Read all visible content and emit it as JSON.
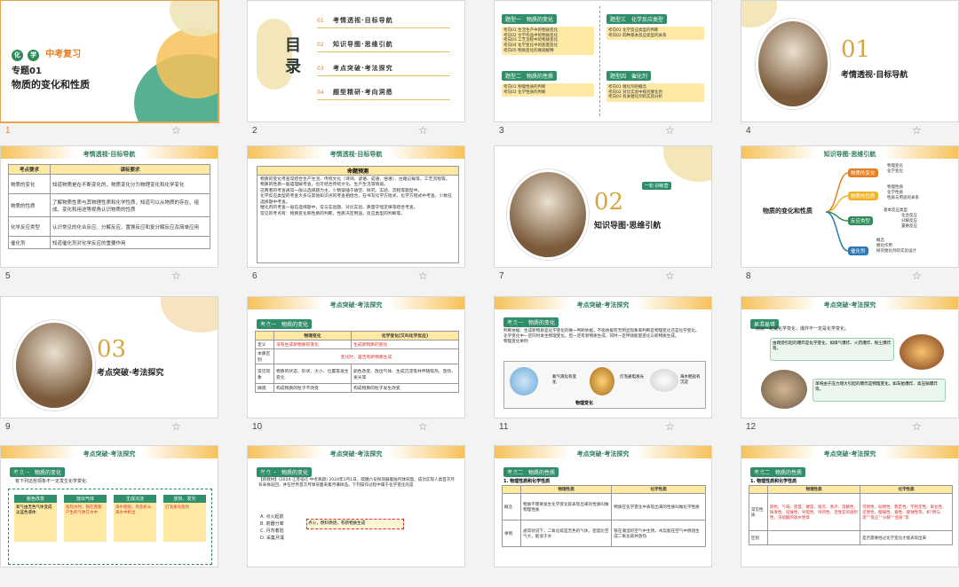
{
  "slides": [
    {
      "num": "1",
      "course_tag": "化 学",
      "course_title": "中考复习",
      "topic_no": "专题01",
      "topic_title": "物质的变化和性质"
    },
    {
      "num": "2",
      "toc_title": "目 录",
      "items": [
        {
          "no": "01",
          "text": "考情透视·目标导航"
        },
        {
          "no": "02",
          "text": "知识导图·思维引航"
        },
        {
          "no": "03",
          "text": "考点突破·考法探究"
        },
        {
          "no": "04",
          "text": "题型精研·考向洞悉"
        }
      ]
    },
    {
      "num": "3",
      "boxes": [
        {
          "head": "题型一　物质的变化",
          "lines": [
            "考向01 生活生产中的物质变化",
            "考向02 文学作品中的物质变化",
            "考向03 工艺流程中的物质变化",
            "考向04 化学变化中的能量变化",
            "考向05 物质变化的微观解释"
          ]
        },
        {
          "head": "题型三　化学反应类型",
          "lines": [
            "考向01 化学反应类型的判断",
            "考向02 四种基本反应类型的关系"
          ]
        },
        {
          "head": "题型二　物质的性质",
          "lines": [
            "考向01 物理性质的判断",
            "考向02 化学性质的判断"
          ]
        },
        {
          "head": "题型四　催化剂",
          "lines": [
            "考向01 催化剂的概念",
            "考向02 对比实验中探究催化剂",
            "考向03 有关催化剂的实验分析"
          ]
        }
      ]
    },
    {
      "num": "4",
      "big_no": "01",
      "title": "考情透视·目标导航"
    },
    {
      "num": "5",
      "header": "考情透视·目标导航",
      "col1": "考点要求",
      "col2": "课标要求",
      "rows": [
        {
          "k": "物质的变化",
          "v": "知道物质是在不断变化的，物质变化分为物理变化和化学变化"
        },
        {
          "k": "物质的性质",
          "v": "了解物质性质与其物理性质和化学性质，知道可以从物质的存在、组成、变化和用途等视角认识物质的性质"
        },
        {
          "k": "化学反应类型",
          "v": "认识常见的化合反应、分解反应、置换反应和复分解反应及简单应用"
        },
        {
          "k": "催化剂",
          "v": "知道催化剂对化学反应的重要作用"
        }
      ]
    },
    {
      "num": "6",
      "header": "考情透视·目标导航",
      "box_title": "命题预测",
      "paras": [
        "物质的变化考查常结合生产生活、传统文化（诗词、谚语、成语、俗语）、古籍记载等，工艺流程等。",
        "物质的性质一般是理解考查，也可结合传统文化、生产生活等情境。",
        "这两者的考查通常一般以选择题为主，少数穿插于填空、探究、实验、流程等题型中。",
        "化学反应类型的考查大多与其他知识点的考查相结合，在书写化学方程式、化学方程式中考查，少数在选择题中考查。",
        "催化剂的考查一般在选择题中，常与实验题、对比实验、质量守恒定律等结合考查。",
        "常见的考点有：物质变化和性质的判断，性质决定用途，反应类型的判断等。"
      ]
    },
    {
      "num": "7",
      "badge": "一轮·训练营",
      "big_no": "02",
      "title": "知识导图·思维引航"
    },
    {
      "num": "8",
      "header": "知识导图·思维引航",
      "center": "物质的变化和性质",
      "branches": [
        {
          "label": "物质的变化",
          "leaves": [
            "物理变化",
            "化学变化"
          ]
        },
        {
          "label": "物质的性质",
          "leaves": [
            "物理性质",
            "化学性质",
            "性质与用途的关系"
          ]
        },
        {
          "label": "反应类型",
          "leaves": [
            "基本反应类型",
            "化合反应",
            "分解反应",
            "置换反应",
            "复分解反应"
          ]
        },
        {
          "label": "催化剂",
          "leaves": [
            "概念",
            "催化作用",
            "探究催化剂的实验设计"
          ]
        }
      ]
    },
    {
      "num": "9",
      "big_no": "03",
      "title": "考点突破·考法探究"
    },
    {
      "num": "10",
      "header": "考点突破·考法探究",
      "tag": "考点一　物质的变化",
      "sub": "知识梳理",
      "cols": [
        "",
        "物理变化",
        "化学变化(又叫化学反应)"
      ],
      "rows": [
        {
          "k": "定义",
          "a": "没有生成新物质的变化",
          "b": "生成新物质的变化"
        },
        {
          "k": "本质区别",
          "a": "变化时，是否有新物质生成",
          "b": ""
        },
        {
          "k": "常见现象",
          "a": "物质的状态、形状、大小、位置等发生变化",
          "b": "颜色改变、放出气体、生成沉淀等并伴随吸热、放热、发光等"
        },
        {
          "k": "微观",
          "a": "构成物质的粒子不改变",
          "b": "构成物质的粒子发生改变"
        }
      ]
    },
    {
      "num": "11",
      "header": "考点突破·考法探究",
      "tag": "考点一　物质的变化",
      "sub": "知识梳理",
      "lines": [
        "判断依据：生成新物质是化学变化的唯一判断依据，不能依据有无明显现象来判断是物理变化还是化学变化。",
        "化学变化中一定同时发生物理变化，但一定有新物质生成，同时一定伴随能量变化与新物质生成。",
        "物理变化举例"
      ],
      "images": [
        "氦气液化有变化",
        "灯泡通电发光",
        "海水晒盐有沉淀"
      ],
      "foot": "物理变化"
    },
    {
      "num": "12",
      "header": "考点突破·考法探究",
      "tag": "易混易错",
      "lines": [
        "燃烧一定是化学变化，爆炸不一定是化学变化。",
        "由燃烧引起的爆炸是化学变化，如煤气爆炸、火药爆炸、粉尘爆炸等。",
        "单纯由于压力增大引起的爆炸是物理变化，如车胎爆炸、高压锅爆炸等。"
      ]
    },
    {
      "num": "13",
      "header": "考点突破·考法探究",
      "tag": "考点一　物质的变化",
      "sub": "易混易错",
      "note": "有下列这些现象不一定发生化学变化:",
      "cards": [
        {
          "head": "颜色改变",
          "body": "氧气由无色气体变成淡蓝色液体"
        },
        {
          "head": "放出气体",
          "body": "加热水时，锅在底部产生的气体在水中"
        },
        {
          "head": "生成沉淀",
          "body": "海水晒盐，有盐析从海水中析出"
        },
        {
          "head": "放热、发光",
          "body": "灯泡发光放热"
        }
      ]
    },
    {
      "num": "14",
      "header": "考点突破·考法探究",
      "tag": "考点一　物质的变化",
      "sub": "新材考查",
      "question": "【新教材】(2024·江苏宿迁·中考真题) 2024年1月1日，嫦娥六号探测器着陆月球背面，成功实现人类首次月背采样返回，并在世界首次月球背面采集月壤样品。下列操作过程中属于化学变化的是",
      "options": [
        "A. 点火起航",
        "B. 箭器分离",
        "C. 月背着陆",
        "D. 采集月壤"
      ],
      "popup": "点火，燃料燃烧，有新物质生成"
    },
    {
      "num": "15",
      "header": "考点突破·考法探究",
      "tag": "考点二　物质的性质",
      "sub": "知识梳理",
      "heading": "1. 物理性质和化学性质",
      "cols": [
        "",
        "物理性质",
        "化学性质"
      ],
      "rows": [
        {
          "k": "概念",
          "a": "物质不需要发生化学变化就表现出来的性质叫做物理性质",
          "b": "物质在化学变化中表现出来的性质叫做化学性质"
        },
        {
          "k": "举例",
          "a": "通常状况下，二氧化碳是无色的气体，密度比空气大，能溶于水",
          "b": "铁在潮湿的空气中生锈，木炭能在空气中燃烧生成二氧化碳并放热"
        }
      ]
    },
    {
      "num": "16",
      "header": "考点突破·考法探究",
      "tag": "考点二　物质的性质",
      "sub": "知识梳理",
      "heading": "1. 物理性质和化学性质",
      "cols": [
        "",
        "物理性质",
        "化学性质"
      ],
      "rows": [
        {
          "k": "常见性质",
          "a": "颜色、气味、密度、硬度、熔点、沸点、溶解性、挥发性、延展性、导电性、导热性、活性炭的吸附性、浓硫酸的吸水性等",
          "b": "可燃性、助燃性、稳定性、不稳定性、氧化性、还原性、酸碱性、毒性、腐蚀性等，如“燃与烧”“反应”“分解”“变质”等"
        },
        {
          "k": "区别",
          "a": "",
          "b": "是否需要经过化学变化才能表现出来"
        }
      ]
    }
  ]
}
